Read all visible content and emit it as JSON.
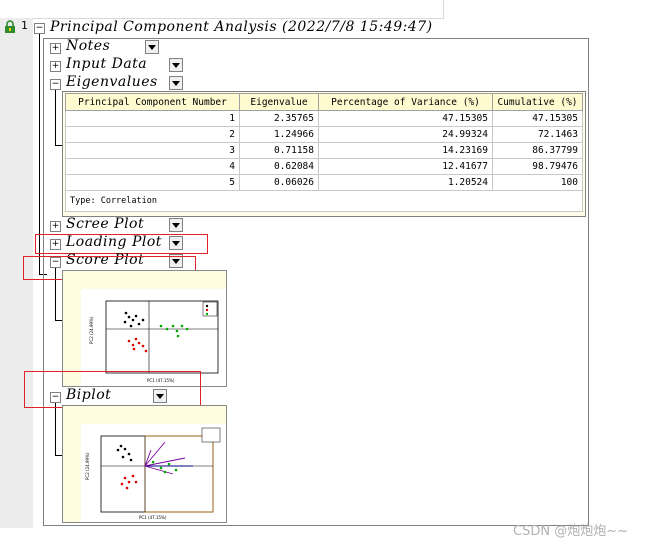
{
  "tree": {
    "root_index": "1",
    "root_title": "Principal Component Analysis (2022/7/8 15:49:47)",
    "nodes": {
      "notes": "Notes",
      "input_data": "Input Data",
      "eigenvalues": "Eigenvalues",
      "scree_plot": "Scree Plot",
      "loading_plot": "Loading Plot",
      "score_plot": "Score Plot",
      "biplot": "Biplot"
    },
    "expand_symbols": {
      "plus": "+",
      "minus": "−"
    }
  },
  "eigen_table": {
    "headers": [
      "Principal Component Number",
      "Eigenvalue",
      "Percentage of Variance (%)",
      "Cumulative (%)"
    ],
    "rows": [
      [
        "1",
        "2.35765",
        "47.15305",
        "47.15305"
      ],
      [
        "2",
        "1.24966",
        "24.99324",
        "72.1463"
      ],
      [
        "3",
        "0.71158",
        "14.23169",
        "86.37799"
      ],
      [
        "4",
        "0.62084",
        "12.41677",
        "98.79476"
      ],
      [
        "5",
        "0.06026",
        "1.20524",
        "100"
      ]
    ],
    "footnote": "Type: Correlation"
  },
  "score_thumb": {
    "xlabel": "PC1 (47.15%)",
    "ylabel": "PC2 (24.99%)"
  },
  "biplot_thumb": {
    "xlabel": "PC1 (47.15%)",
    "ylabel": "PC2 (24.99%)"
  },
  "watermark": "CSDN @炮炮炮~~",
  "colors": {
    "highlight": "#e0202a",
    "lock_icon": "#2e8b2e",
    "panel_bg": "#fffde8"
  }
}
